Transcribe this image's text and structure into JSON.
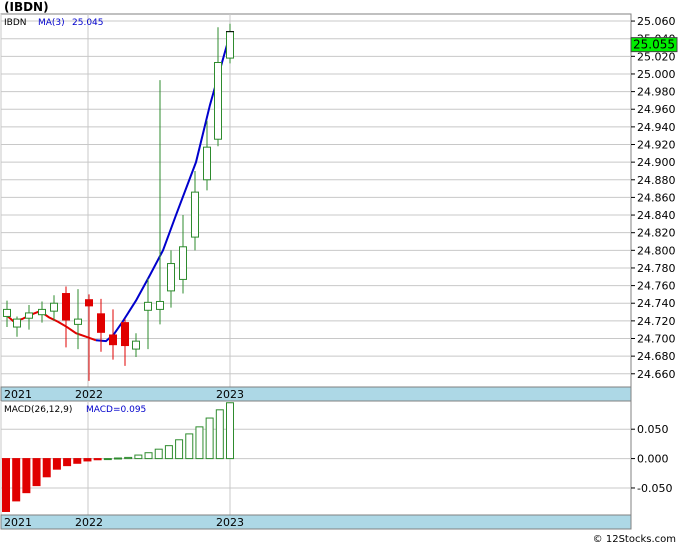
{
  "header": {
    "ticker_title": "(IBDN)"
  },
  "colors": {
    "up": "#2e8b2e",
    "down": "#e00000",
    "ma_blue": "#0000cc",
    "ma_red": "#e00000",
    "axis_strip": "#add8e6",
    "grid": "#c8c8c8",
    "price_box": "#00ee00",
    "text": "#000000",
    "macd_label": "#0000cc"
  },
  "chart_data": [
    {
      "type": "candlestick",
      "title": "(IBDN)",
      "legend": {
        "symbol": "IBDN",
        "ma_label": "MA(3)",
        "ma_value": "25.045"
      },
      "last_price_label": "25.055",
      "x_tick_labels": [
        {
          "label": "2021",
          "index": 0
        },
        {
          "label": "2022",
          "index": 12
        },
        {
          "label": "2023",
          "index": 33
        }
      ],
      "y_tick_labels": [
        "24.660",
        "24.680",
        "24.700",
        "24.720",
        "24.740",
        "24.760",
        "24.780",
        "24.800",
        "24.820",
        "24.840",
        "24.860",
        "24.880",
        "24.900",
        "24.920",
        "24.940",
        "24.960",
        "24.980",
        "25.000",
        "25.020",
        "25.040",
        "25.060"
      ],
      "ylim": [
        24.645,
        25.068
      ],
      "grid": true,
      "candles": [
        {
          "o": 24.725,
          "h": 24.743,
          "l": 24.713,
          "c": 24.733
        },
        {
          "o": 24.713,
          "h": 24.725,
          "l": 24.702,
          "c": 24.722
        },
        {
          "o": 24.723,
          "h": 24.738,
          "l": 24.71,
          "c": 24.729
        },
        {
          "o": 24.727,
          "h": 24.742,
          "l": 24.718,
          "c": 24.733
        },
        {
          "o": 24.731,
          "h": 24.749,
          "l": 24.72,
          "c": 24.74
        },
        {
          "o": 24.751,
          "h": 24.759,
          "l": 24.69,
          "c": 24.721
        },
        {
          "o": 24.716,
          "h": 24.756,
          "l": 24.688,
          "c": 24.722
        },
        {
          "o": 24.744,
          "h": 24.75,
          "l": 24.652,
          "c": 24.737
        },
        {
          "o": 24.728,
          "h": 24.745,
          "l": 24.685,
          "c": 24.707
        },
        {
          "o": 24.704,
          "h": 24.733,
          "l": 24.676,
          "c": 24.693
        },
        {
          "o": 24.718,
          "h": 24.722,
          "l": 24.669,
          "c": 24.692
        },
        {
          "o": 24.688,
          "h": 24.706,
          "l": 24.679,
          "c": 24.697
        },
        {
          "o": 24.732,
          "h": 24.768,
          "l": 24.688,
          "c": 24.741
        },
        {
          "o": 24.733,
          "h": 24.993,
          "l": 24.716,
          "c": 24.742
        },
        {
          "o": 24.754,
          "h": 24.8,
          "l": 24.735,
          "c": 24.785
        },
        {
          "o": 24.767,
          "h": 24.84,
          "l": 24.751,
          "c": 24.804
        },
        {
          "o": 24.815,
          "h": 24.89,
          "l": 24.8,
          "c": 24.866
        },
        {
          "o": 24.88,
          "h": 24.947,
          "l": 24.868,
          "c": 24.917
        },
        {
          "o": 24.926,
          "h": 25.053,
          "l": 24.918,
          "c": 25.013
        },
        {
          "o": 25.018,
          "h": 25.057,
          "l": 25.012,
          "c": 25.048
        }
      ],
      "ma": [
        24.726,
        24.72,
        24.722,
        24.727,
        24.731,
        24.724,
        24.719,
        24.713,
        24.706,
        24.702,
        24.698,
        24.697,
        24.705,
        24.718,
        24.743,
        24.772,
        24.8,
        24.84,
        24.9,
        24.965,
        25.045
      ],
      "ma_split_index": 10
    },
    {
      "type": "bar",
      "title": "",
      "legend": {
        "name": "MACD(26,12,9)",
        "value_label": "MACD=0.095"
      },
      "x_tick_labels": [
        "2021",
        "2022",
        "2023"
      ],
      "y_tick_labels": [
        "0.050",
        "0.000",
        "-0.050"
      ],
      "y_ticks": [
        0.05,
        0.0,
        -0.05
      ],
      "ylim": [
        -0.096,
        0.098
      ],
      "values": [
        -0.09,
        -0.072,
        -0.058,
        -0.046,
        -0.031,
        -0.018,
        -0.012,
        -0.008,
        -0.004,
        -0.002,
        0.0,
        0.001,
        0.002,
        0.006,
        0.01,
        0.016,
        0.022,
        0.032,
        0.042,
        0.054,
        0.069,
        0.083,
        0.095
      ]
    }
  ],
  "footer": {
    "copyright": "© 12Stocks.com"
  }
}
